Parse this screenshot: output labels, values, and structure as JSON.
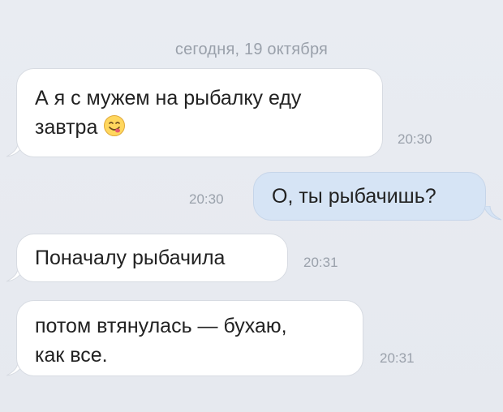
{
  "date_separator": "сегодня, 19 октября",
  "messages": [
    {
      "direction": "incoming",
      "lines": [
        "А я с мужем на рыбалку еду",
        "завтра"
      ],
      "emoji": "face-savoring-food-icon",
      "time": "20:30"
    },
    {
      "direction": "outgoing",
      "lines": [
        "О, ты рыбачишь?"
      ],
      "time": "20:30"
    },
    {
      "direction": "incoming",
      "lines": [
        "Поначалу рыбачила"
      ],
      "time": "20:31"
    },
    {
      "direction": "incoming",
      "lines": [
        "потом втянулась — бухаю,",
        "как все."
      ],
      "time": "20:31"
    }
  ],
  "colors": {
    "background": "#e8ebf1",
    "incoming_bubble": "#ffffff",
    "outgoing_bubble": "#d6e4f5",
    "timestamp": "#9aa1ab",
    "text": "#222222"
  }
}
